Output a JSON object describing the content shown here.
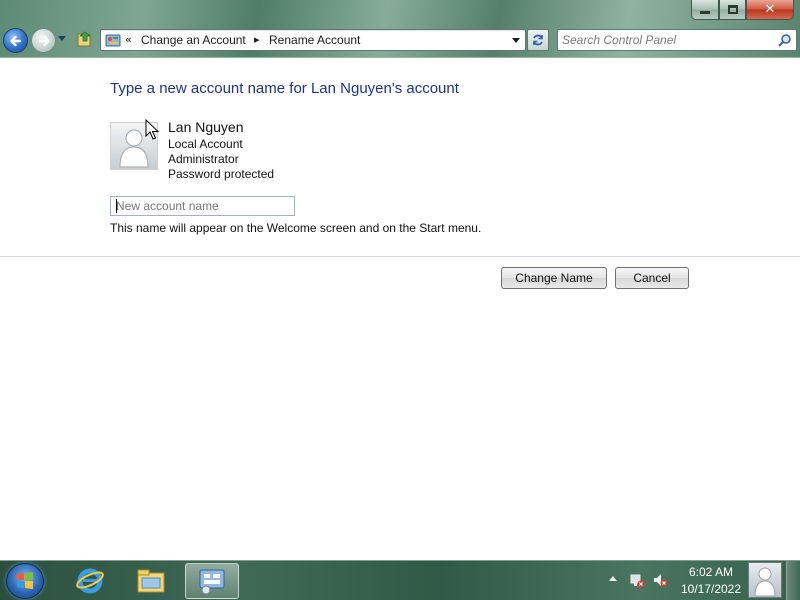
{
  "window": {
    "caption_buttons": {
      "minimize_icon": "minimize-icon",
      "maximize_icon": "maximize-icon",
      "close_glyph": "✕"
    }
  },
  "nav": {
    "back_icon": "back-arrow-icon",
    "forward_icon": "forward-arrow-icon"
  },
  "address": {
    "overflow": "«",
    "separator": "▸",
    "crumbs": [
      "Change an Account",
      "Rename Account"
    ],
    "refresh_icon": "refresh-icon"
  },
  "search": {
    "placeholder": "Search Control Panel",
    "icon": "search-icon"
  },
  "main": {
    "title": "Type a new account name for Lan Nguyen's account",
    "account": {
      "name": "Lan Nguyen",
      "type": "Local Account",
      "role": "Administrator",
      "password_status": "Password protected"
    },
    "input": {
      "placeholder": "New account name",
      "value": ""
    },
    "hint": "This name will appear on the Welcome screen and on the Start menu.",
    "buttons": {
      "change": "Change Name",
      "cancel": "Cancel"
    }
  },
  "taskbar": {
    "apps": [
      "internet-explorer",
      "windows-explorer",
      "control-panel"
    ],
    "clock": {
      "time": "6:02 AM",
      "date": "10/17/2022"
    },
    "accent": "#3e6a56"
  }
}
